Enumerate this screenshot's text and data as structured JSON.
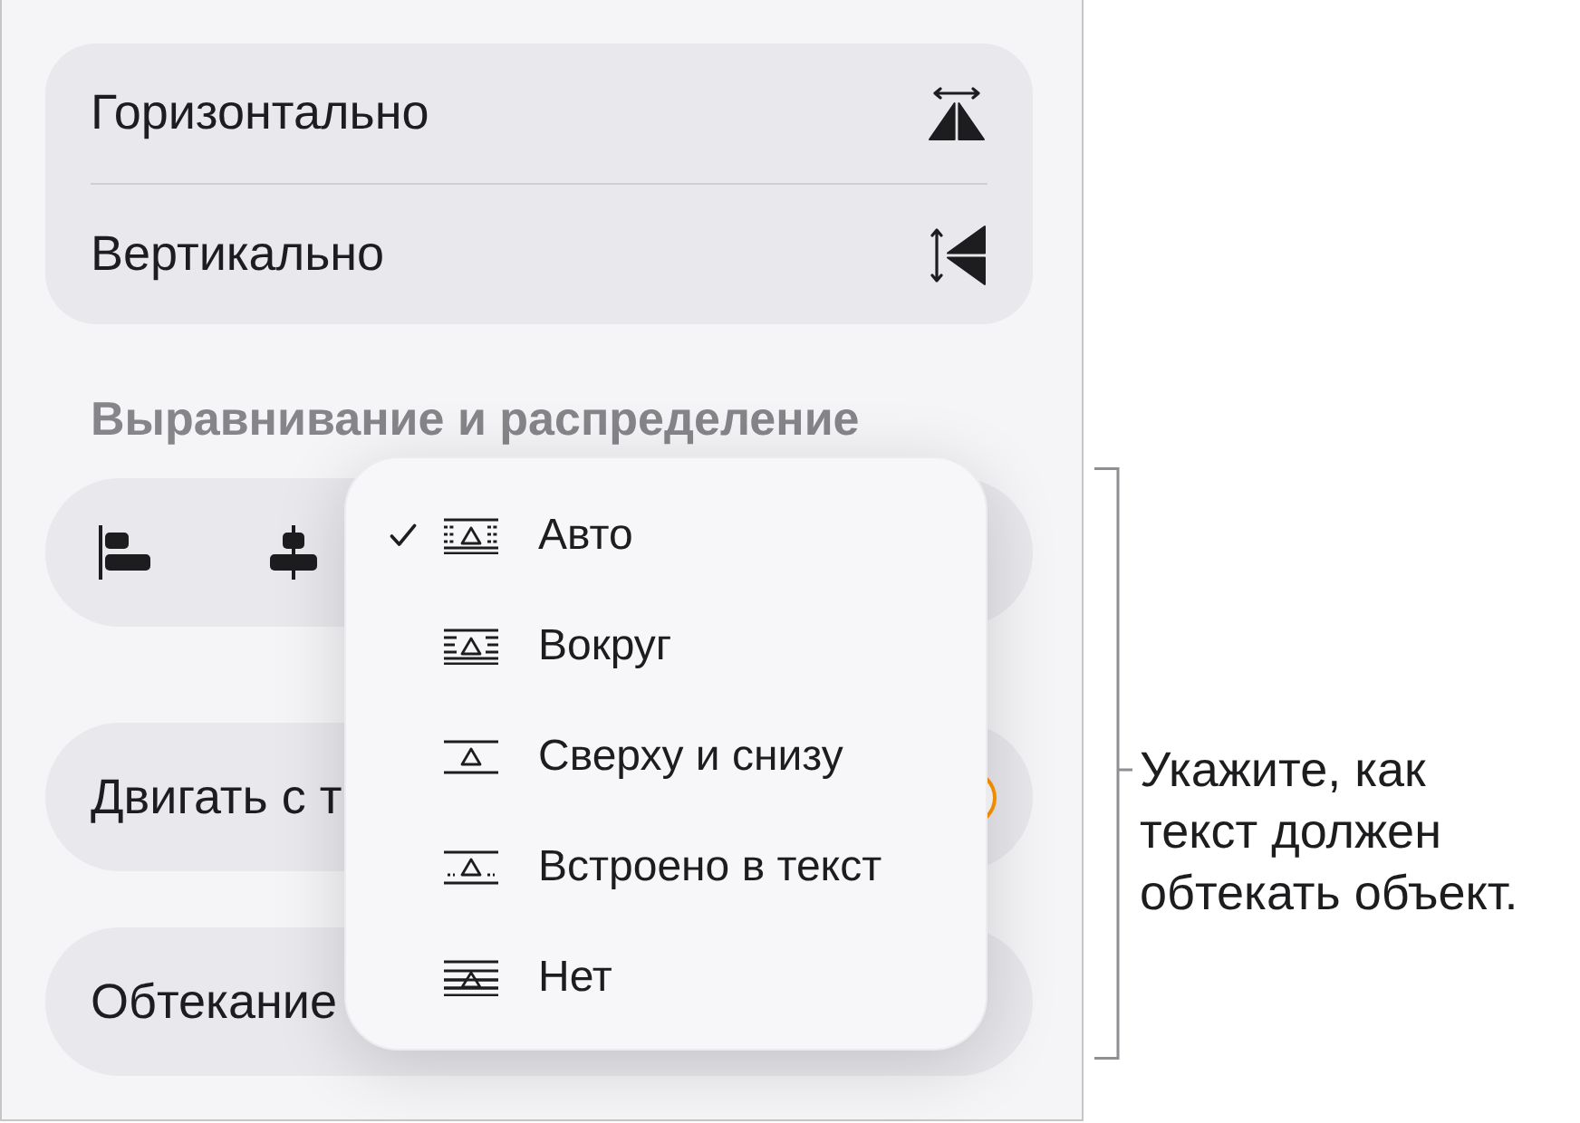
{
  "flip_options": [
    {
      "label": "Горизонтально",
      "kind": "horizontal"
    },
    {
      "label": "Вертикально",
      "kind": "vertical"
    }
  ],
  "align_section": {
    "title": "Выравнивание и распределение",
    "buttons": [
      {
        "kind": "left"
      },
      {
        "kind": "center"
      }
    ]
  },
  "move_with_text": {
    "label": "Двигать с т",
    "on": true
  },
  "wrap_row": {
    "label": "Обтекание"
  },
  "wrap_menu": {
    "items": [
      {
        "label": "Авто",
        "kind": "auto",
        "selected": true
      },
      {
        "label": "Вокруг",
        "kind": "around",
        "selected": false
      },
      {
        "label": "Сверху и снизу",
        "kind": "topbottom",
        "selected": false
      },
      {
        "label": "Встроено в текст",
        "kind": "inline",
        "selected": false
      },
      {
        "label": "Нет",
        "kind": "none",
        "selected": false
      }
    ]
  },
  "callout": {
    "text": "Укажите, как текст должен обтекать объект."
  }
}
